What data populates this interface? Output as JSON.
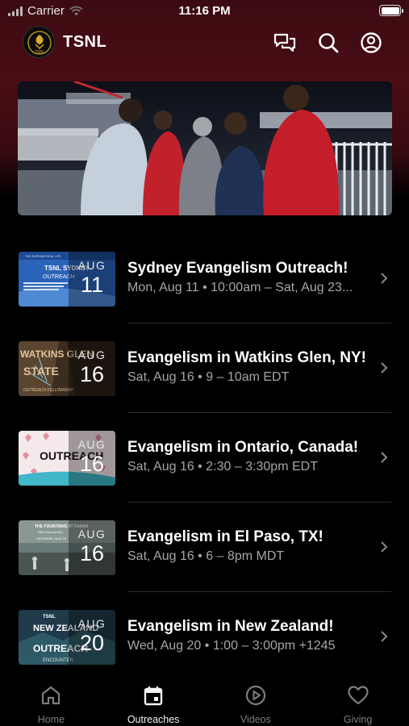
{
  "status_bar": {
    "carrier": "Carrier",
    "time": "11:16 PM"
  },
  "header": {
    "title": "TSNL",
    "logo_text": "TSNL",
    "icons": [
      "chat-icon",
      "search-icon",
      "profile-icon"
    ]
  },
  "events": [
    {
      "title": "Sydney Evangelism Outreach!",
      "subtitle": "Mon, Aug 11 • 10:00am – Sat, Aug 23...",
      "month": "AUG",
      "day": "11",
      "thumb_text": [
        "THE SUPERNATURAL LIFE",
        "TSNL SYDNEY",
        "OUTREACH"
      ]
    },
    {
      "title": "Evangelism in Watkins Glen, NY!",
      "subtitle": "Sat, Aug 16 • 9 – 10am EDT",
      "month": "AUG",
      "day": "16",
      "thumb_text": [
        "WATKINS GLEN",
        "STATE",
        "OUTREACH FELLOWSHIP"
      ]
    },
    {
      "title": "Evangelism in Ontario, Canada!",
      "subtitle": "Sat, Aug 16 • 2:30 – 3:30pm EDT",
      "month": "AUG",
      "day": "16",
      "thumb_text": [
        "OUTREACH"
      ]
    },
    {
      "title": "Evangelism in El Paso, TX!",
      "subtitle": "Sat, Aug 16 • 6 – 8pm MDT",
      "month": "AUG",
      "day": "16",
      "thumb_text": [
        "THE FOUNTAINS AT FARAH",
        "8889 Gateway Blvd",
        "SATURDAY, AUG 16"
      ]
    },
    {
      "title": "Evangelism in New Zealand!",
      "subtitle": "Wed, Aug 20 • 1:00 – 3:00pm +1245",
      "month": "AUG",
      "day": "20",
      "thumb_text": [
        "TSNL",
        "NEW ZEALAND",
        "OUTREACH",
        "ENCOUNTER"
      ]
    }
  ],
  "tabs": [
    {
      "label": "Home",
      "icon": "home-icon",
      "active": false
    },
    {
      "label": "Outreaches",
      "icon": "calendar-icon",
      "active": true
    },
    {
      "label": "Videos",
      "icon": "play-icon",
      "active": false
    },
    {
      "label": "Giving",
      "icon": "heart-icon",
      "active": false
    }
  ],
  "colors": {
    "accent_top": "#4a0d15",
    "background": "#000000",
    "subtitle": "#a6a6a6"
  }
}
